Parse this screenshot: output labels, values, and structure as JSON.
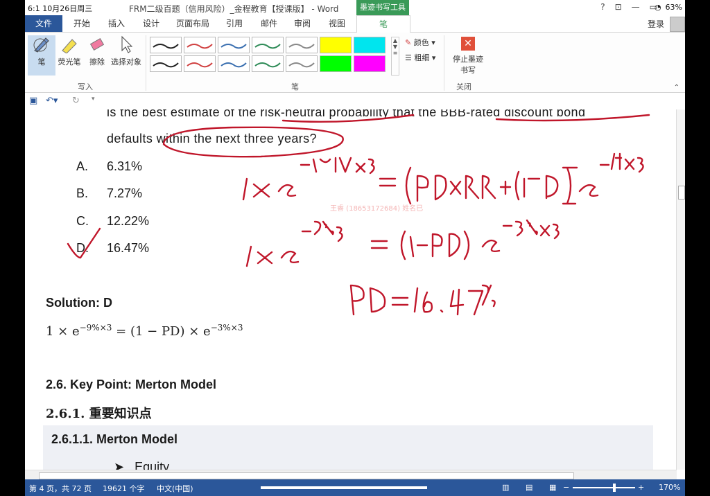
{
  "system": {
    "time": "6:1 10月26日周三",
    "battery": "63%"
  },
  "window": {
    "title": "FRM二级百题（信用风险）_金程教育【授课版】 - Word",
    "ink_tools_tab": "墨迹书写工具",
    "help": "?",
    "minimize": "—",
    "restore": "▭",
    "close": "✕"
  },
  "tabs": [
    "文件",
    "开始",
    "插入",
    "设计",
    "页面布局",
    "引用",
    "邮件",
    "审阅",
    "视图",
    "笔"
  ],
  "login": "登录",
  "ribbon": {
    "write_group": "写入",
    "pen_group": "笔",
    "close_group": "关闭",
    "pen": "笔",
    "highlighter": "荧光笔",
    "eraser": "擦除",
    "select_objects": "选择对象",
    "color": "颜色",
    "thickness": "粗细",
    "stop_inking": "停止墨迹书写",
    "pen_colors": [
      "#222222",
      "#d04040",
      "#3a6fb0",
      "#2e8b57",
      "#888888",
      "#ffff00",
      "#00e5ee",
      "#222222",
      "#d04040",
      "#3a6fb0",
      "#2e8b57",
      "#888888",
      "#00ff00",
      "#ff00ff"
    ]
  },
  "document": {
    "question_line1": "is the best estimate of the risk-neutral probability that the BBB-rated discount bond",
    "question_line2": "defaults within the next three years?",
    "options": [
      {
        "letter": "A.",
        "value": "6.31%"
      },
      {
        "letter": "B.",
        "value": "7.27%"
      },
      {
        "letter": "C.",
        "value": "12.22%"
      },
      {
        "letter": "D.",
        "value": "16.47%"
      }
    ],
    "solution": "Solution: D",
    "equation_left": "1 × e",
    "equation_exp1": "−9%×3",
    "equation_mid": " = (1 − PD) × e",
    "equation_exp2": "−3%×3",
    "h26": "2.6.    Key Point: Merton Model",
    "h261": "2.6.1.    重要知识点",
    "h2611": "2.6.1.1.    Merton Model",
    "bullet": "Equity",
    "watermark": "王睿 (18653172684) 姓名已"
  },
  "status": {
    "page": "第 4 页，共 72 页",
    "words": "19621 个字",
    "lang": "中文(中国)",
    "zoom": "170%"
  }
}
